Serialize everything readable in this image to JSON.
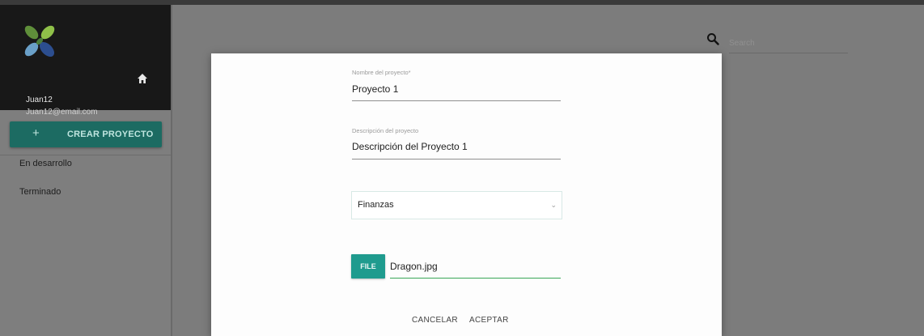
{
  "sidebar": {
    "user_name": "Juan12",
    "user_email": "Juan12@email.com",
    "create_button_icon": "+",
    "create_button_label": "CREAR PROYECTO",
    "items": [
      {
        "label": "En desarrollo"
      },
      {
        "label": "Terminado"
      }
    ]
  },
  "header": {
    "search_placeholder": "Search"
  },
  "dialog": {
    "name_label": "Nombre del proyecto*",
    "name_value": "Proyecto 1",
    "description_label": "Descripción del proyecto",
    "description_value": "Descripción del Proyecto 1",
    "category_value": "Finanzas",
    "file_button_label": "FILE",
    "file_name": "Dragon.jpg",
    "cancel_label": "CANCELAR",
    "accept_label": "ACEPTAR"
  },
  "colors": {
    "accent": "#1f9b8e",
    "sidebar_head": "#181818",
    "overlay": "#7c7c7c",
    "file_underline": "#3aa757"
  },
  "icons": {
    "logo": "leaf-logo-icon",
    "home": "home-icon",
    "search": "search-icon",
    "dropdown": "chevron-down-icon"
  }
}
